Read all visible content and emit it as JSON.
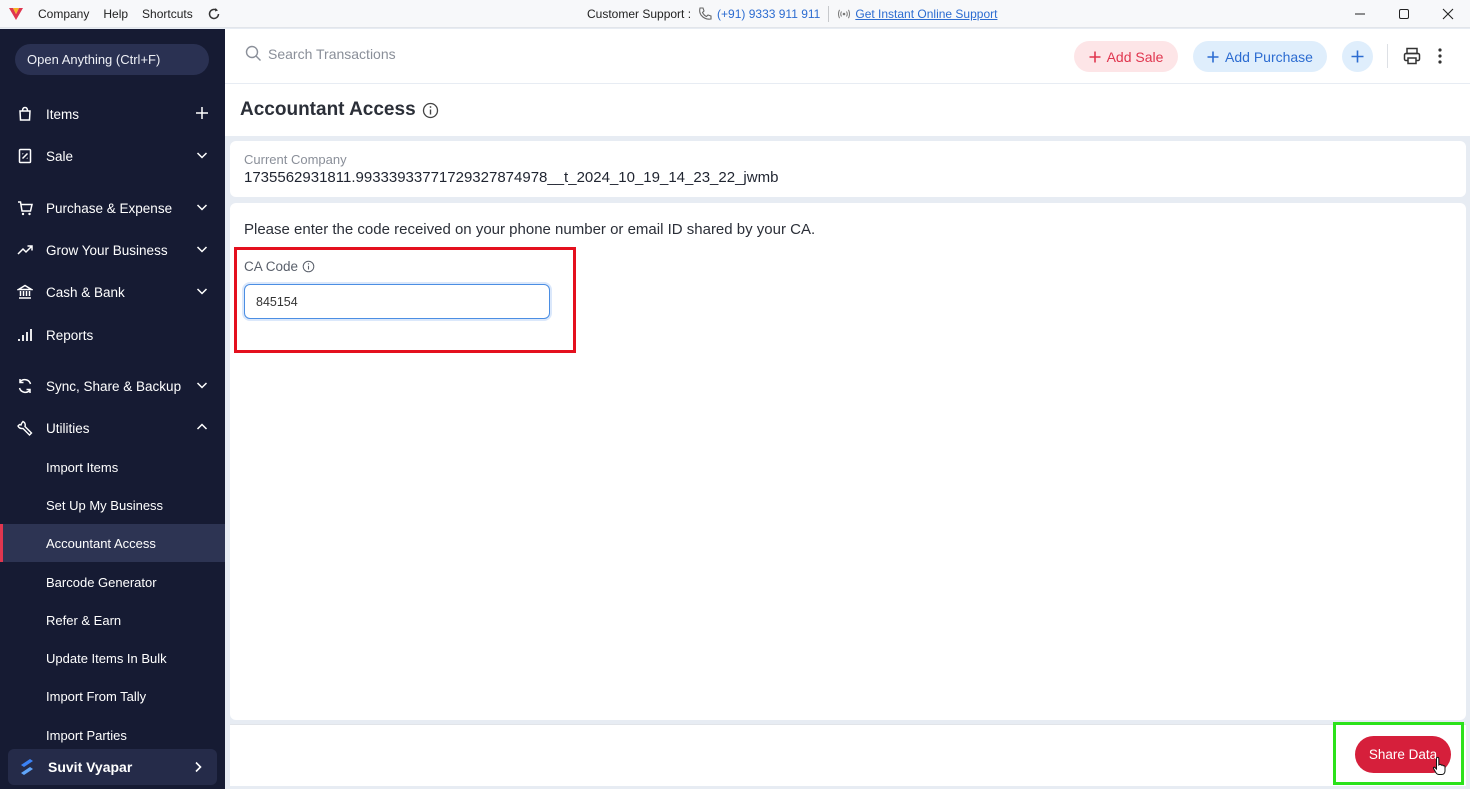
{
  "titlebar": {
    "menu": [
      "Company",
      "Help",
      "Shortcuts"
    ],
    "support_label": "Customer Support :",
    "support_phone": "(+91) 9333 911 911",
    "support_link": "Get Instant Online Support"
  },
  "sidebar": {
    "open_anything": "Open Anything (Ctrl+F)",
    "items": {
      "items": "Items",
      "sale": "Sale",
      "purchase": "Purchase & Expense",
      "grow": "Grow Your Business",
      "cash": "Cash & Bank",
      "reports": "Reports",
      "sync": "Sync, Share & Backup",
      "utilities": "Utilities"
    },
    "sub_items": [
      "Import Items",
      "Set Up My Business",
      "Accountant Access",
      "Barcode Generator",
      "Refer & Earn",
      "Update Items In Bulk",
      "Import From Tally",
      "Import Parties"
    ],
    "active_sub_item": "Accountant Access",
    "suvit": "Suvit Vyapar"
  },
  "topbar": {
    "search_placeholder": "Search Transactions",
    "add_sale": "Add Sale",
    "add_purchase": "Add Purchase"
  },
  "page": {
    "title": "Accountant Access",
    "company_label": "Current Company",
    "company_value": "1735562931811.9933393377172932787497​8__t_2024_10_19_14_23_22_jwmb",
    "instruction": "Please enter the code received on your phone number or email ID shared by your CA.",
    "ca_code_label": "CA Code",
    "ca_code_value": "845154",
    "share_button": "Share Data"
  },
  "colors": {
    "sidebar_bg": "#161b33",
    "accent_red": "#d61f3b",
    "accent_blue": "#2c6cd1"
  }
}
